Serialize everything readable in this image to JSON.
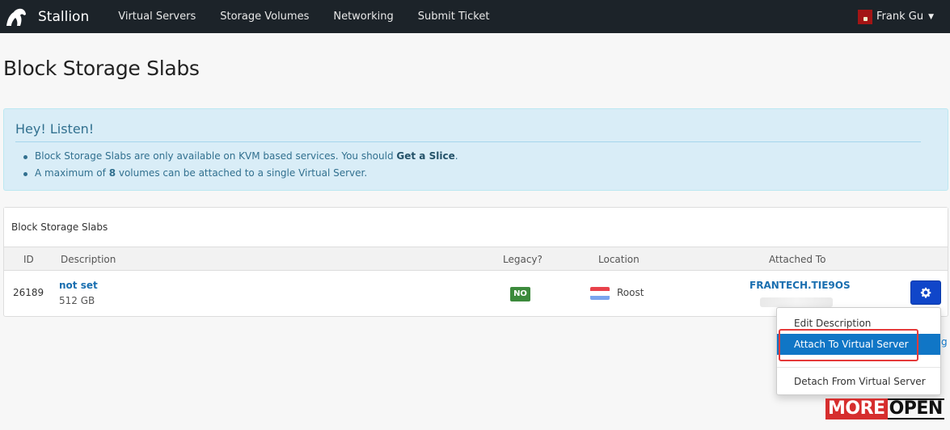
{
  "navbar": {
    "brand": "Stallion",
    "links": [
      "Virtual Servers",
      "Storage Volumes",
      "Networking",
      "Submit Ticket"
    ],
    "user": "Frank Gu",
    "bg_color": "#1c2329"
  },
  "page": {
    "title": "Block Storage Slabs"
  },
  "alert": {
    "heading": "Hey! Listen!",
    "line1_prefix": "Block Storage Slabs are only available on KVM based services. You should ",
    "line1_link": "Get a Slice",
    "line1_suffix": ".",
    "line2_prefix": "A maximum of ",
    "line2_bold": "8",
    "line2_suffix": " volumes can be attached to a single Virtual Server.",
    "color": "#31708f"
  },
  "panel": {
    "title": "Block Storage Slabs",
    "columns": {
      "id": "ID",
      "description": "Description",
      "legacy": "Legacy?",
      "location": "Location",
      "attached_to": "Attached To"
    },
    "row": {
      "id": "26189",
      "description": "not set",
      "size": "512 GB",
      "legacy": "NO",
      "location": "Roost",
      "attached_to": "FRANTECH.TIE9OS"
    }
  },
  "dropdown": {
    "items": [
      "Edit Description",
      "Attach To Virtual Server",
      "Detach From Virtual Server"
    ],
    "active_item": "Attach To Virtual Server",
    "accent_color": "#1076c6"
  },
  "watermark": {
    "part1": "MORE",
    "part2": "OPEN"
  },
  "icons": [
    "horse-logo-icon",
    "user-avatar-icon",
    "caret-down-icon",
    "netherlands-flag-icon",
    "gear-icon"
  ]
}
